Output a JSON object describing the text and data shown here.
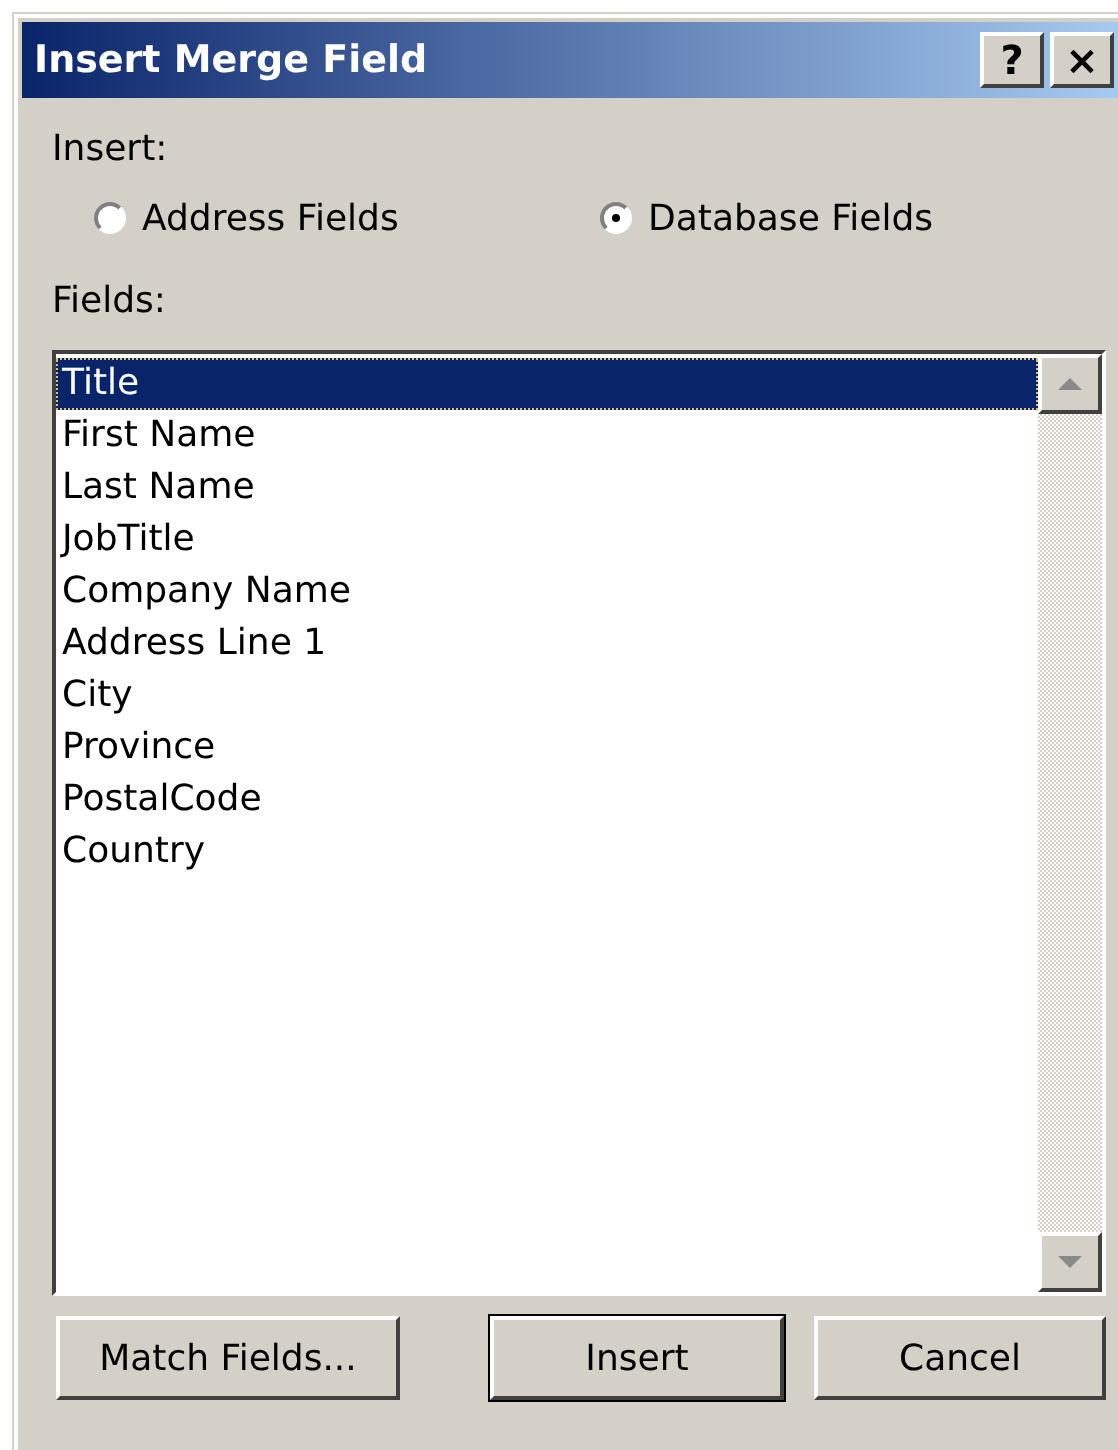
{
  "window": {
    "title": "Insert Merge Field",
    "title_buttons": [
      "?",
      "×"
    ]
  },
  "insert": {
    "label": "Insert:",
    "options": [
      {
        "label": "Address Fields",
        "selected": false
      },
      {
        "label": "Database Fields",
        "selected": true
      }
    ]
  },
  "fields": {
    "label": "Fields:",
    "items": [
      {
        "label": "Title",
        "selected": true
      },
      {
        "label": "First Name",
        "selected": false
      },
      {
        "label": "Last Name",
        "selected": false
      },
      {
        "label": "JobTitle",
        "selected": false
      },
      {
        "label": "Company Name",
        "selected": false
      },
      {
        "label": "Address Line 1",
        "selected": false
      },
      {
        "label": "City",
        "selected": false
      },
      {
        "label": "Province",
        "selected": false
      },
      {
        "label": "PostalCode",
        "selected": false
      },
      {
        "label": "Country",
        "selected": false
      }
    ]
  },
  "buttons": [
    {
      "label": "Match Fields...",
      "default": false
    },
    {
      "label": "Insert",
      "default": true
    },
    {
      "label": "Cancel",
      "default": false
    }
  ]
}
